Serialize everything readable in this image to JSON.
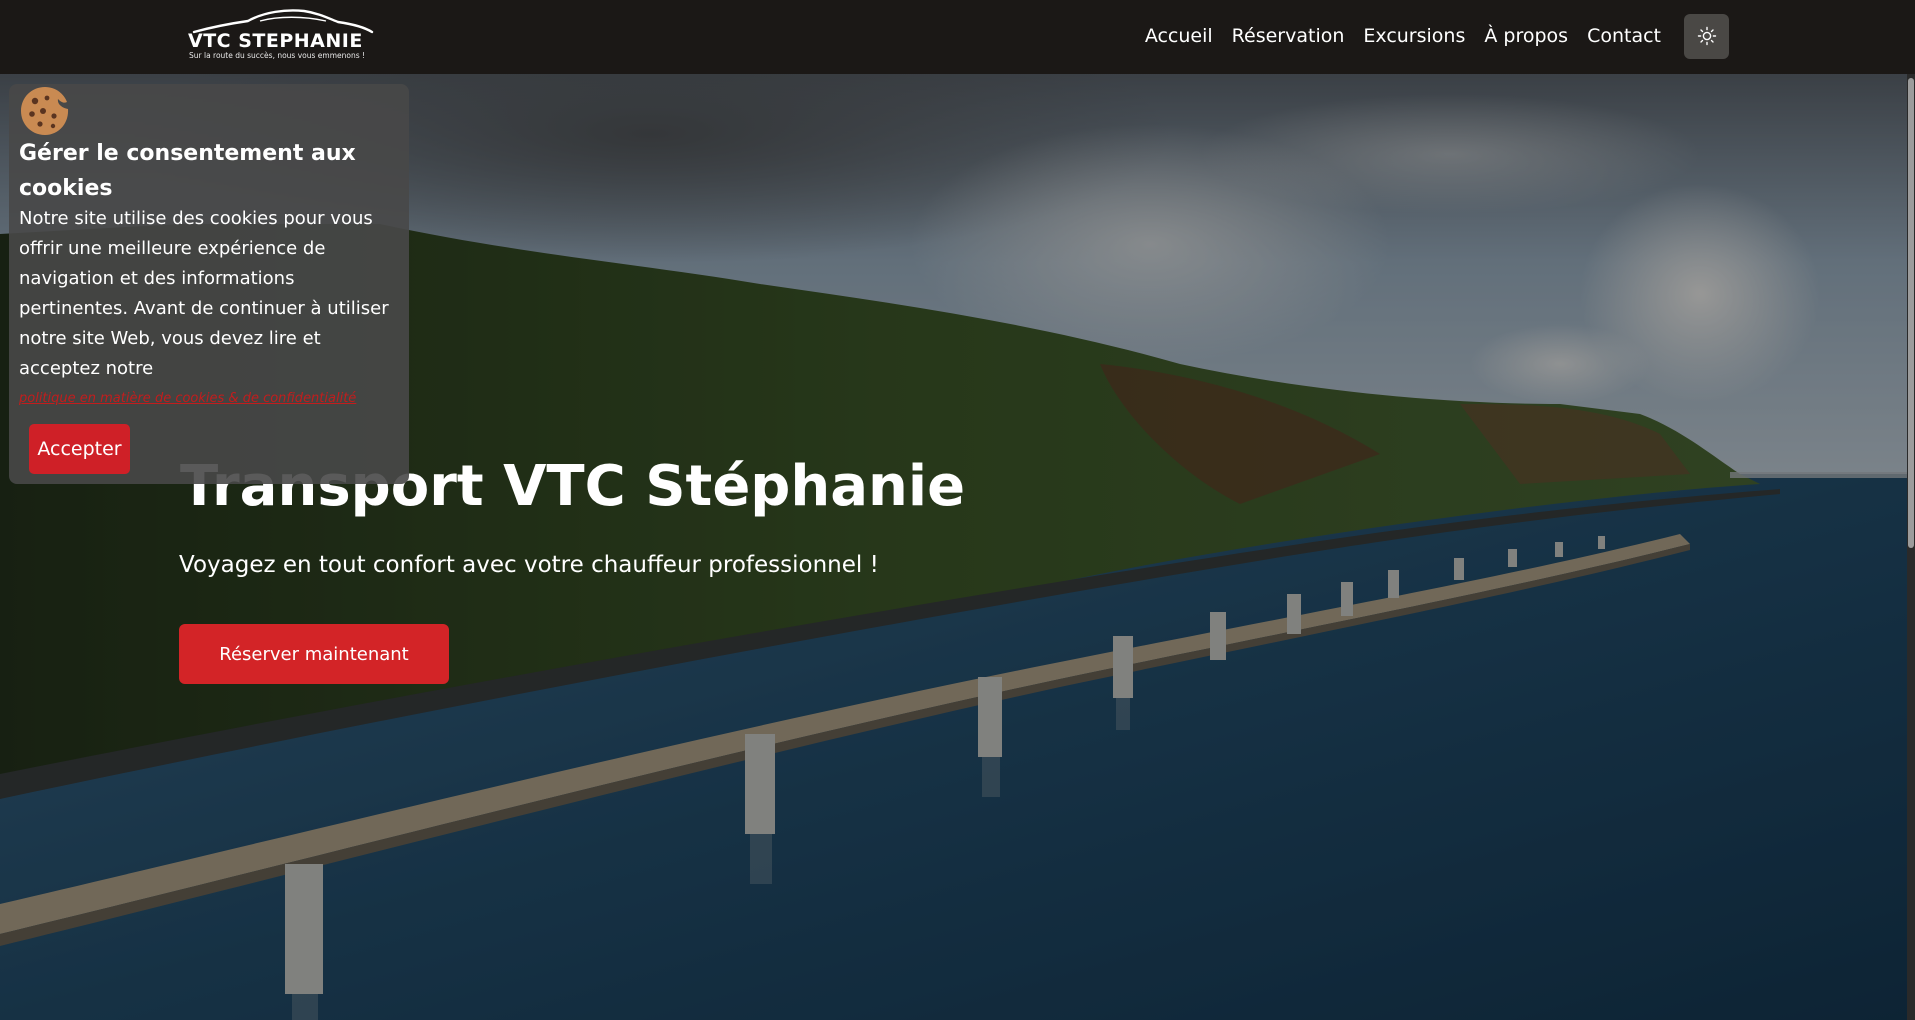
{
  "brand": {
    "name": "VTC STEPHANIE",
    "tagline": "Sur la route du succès, nous vous emmenons !"
  },
  "nav": {
    "items": [
      {
        "label": "Accueil"
      },
      {
        "label": "Réservation"
      },
      {
        "label": "Excursions"
      },
      {
        "label": "À propos"
      },
      {
        "label": "Contact"
      }
    ],
    "theme_toggle_icon": "sun-icon"
  },
  "hero": {
    "title": "Transport VTC Stéphanie",
    "subtitle": "Voyagez en tout confort avec votre chauffeur professionnel !",
    "cta_label": "Réserver maintenant"
  },
  "cookie_banner": {
    "icon": "cookie-icon",
    "title": "Gérer le consentement aux cookies",
    "body": "Notre site utilise des cookies pour vous offrir une meilleure expérience de navigation et des informations pertinentes. Avant de continuer à utiliser notre site Web, vous devez lire et acceptez notre",
    "policy_link": "politique en matière de cookies & de confidentialité",
    "accept_label": "Accepter"
  },
  "colors": {
    "header_bg": "#1b1816",
    "accent_red": "#d32427",
    "banner_bg": "#484848"
  }
}
